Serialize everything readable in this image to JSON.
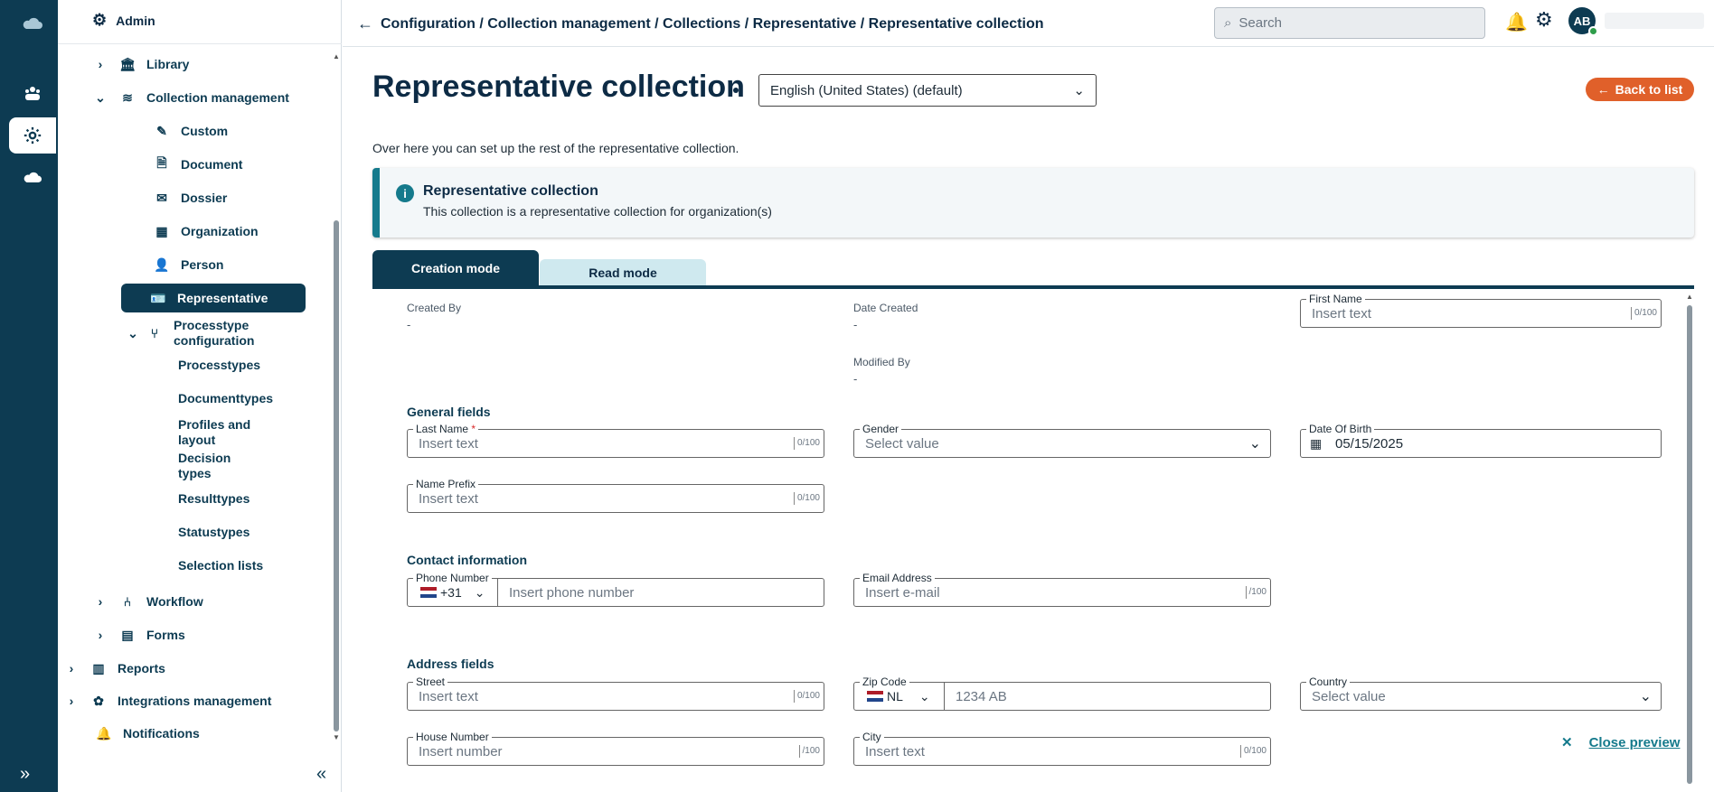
{
  "rail": {
    "icons": [
      "cloud-logo-icon",
      "cases-icon",
      "settings-icon",
      "cloud-icon"
    ],
    "expand": "»"
  },
  "sidebar": {
    "header": "Admin",
    "items": [
      {
        "label": "Library"
      },
      {
        "label": "Collection management"
      },
      {
        "label": "Custom"
      },
      {
        "label": "Document"
      },
      {
        "label": "Dossier"
      },
      {
        "label": "Organization"
      },
      {
        "label": "Person"
      },
      {
        "label": "Representative"
      },
      {
        "label": "Processtype configuration"
      },
      {
        "label": "Processtypes"
      },
      {
        "label": "Documenttypes"
      },
      {
        "label": "Profiles and layout"
      },
      {
        "label": "Decision types"
      },
      {
        "label": "Resulttypes"
      },
      {
        "label": "Statustypes"
      },
      {
        "label": "Selection lists"
      },
      {
        "label": "Workflow"
      },
      {
        "label": "Forms"
      },
      {
        "label": "Reports"
      },
      {
        "label": "Integrations management"
      },
      {
        "label": "Notifications"
      }
    ],
    "collapse": "«"
  },
  "topbar": {
    "breadcrumb": "Configuration / Collection management / Collections / Representative / Representative collection",
    "search_placeholder": "Search",
    "avatar": "AB"
  },
  "page": {
    "title": "Representative collection",
    "language": "English (United States) (default)",
    "back_label": "Back to list",
    "intro": "Over here you can set up the rest of the representative collection.",
    "info_title": "Representative collection",
    "info_text": "This collection is a representative collection for organization(s)",
    "tabs": [
      "Creation mode",
      "Read mode"
    ]
  },
  "form": {
    "meta": {
      "created_by_label": "Created By",
      "created_by_value": "-",
      "date_created_label": "Date Created",
      "date_created_value": "-",
      "modified_by_label": "Modified By",
      "modified_by_value": "-"
    },
    "first_name": {
      "label": "First Name",
      "placeholder": "Insert text",
      "count": "0/100"
    },
    "general_title": "General fields",
    "last_name": {
      "label": "Last Name",
      "required": "*",
      "placeholder": "Insert text",
      "count": "0/100"
    },
    "gender": {
      "label": "Gender",
      "placeholder": "Select value"
    },
    "dob": {
      "label": "Date Of Birth",
      "value": "05/15/2025"
    },
    "name_prefix": {
      "label": "Name Prefix",
      "placeholder": "Insert text",
      "count": "0/100"
    },
    "contact_title": "Contact information",
    "phone": {
      "label": "Phone Number",
      "code": "+31",
      "placeholder": "Insert phone number"
    },
    "email": {
      "label": "Email Address",
      "placeholder": "Insert e-mail",
      "count": "/100"
    },
    "address_title": "Address fields",
    "street": {
      "label": "Street",
      "placeholder": "Insert text",
      "count": "0/100"
    },
    "zip": {
      "label": "Zip Code",
      "country": "NL",
      "placeholder": "1234 AB"
    },
    "country": {
      "label": "Country",
      "placeholder": "Select value"
    },
    "house_number": {
      "label": "House Number",
      "placeholder": "Insert number",
      "count": "/100"
    },
    "city": {
      "label": "City",
      "placeholder": "Insert text",
      "count": "0/100"
    }
  },
  "preview": {
    "close_label": "Close preview"
  }
}
